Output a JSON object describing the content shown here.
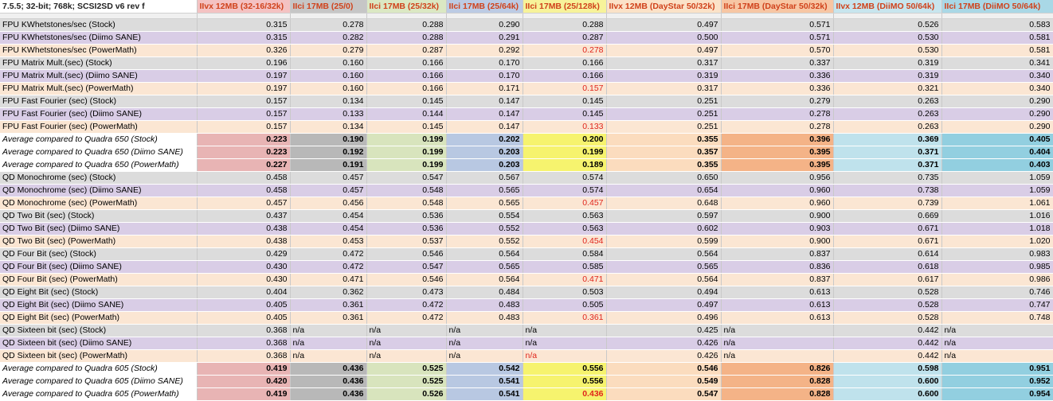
{
  "sheet": {
    "title": "7.5.5; 32-bit; 768k; SCSI2SD v6 rev f",
    "columns": [
      "IIvx 12MB (32-16/32k)",
      "IIci 17MB (25/0)",
      "IIci 17MB (25/32k)",
      "IIci 17MB (25/64k)",
      "IIci 17MB (25/128k)",
      "IIvx 12MB (DayStar 50/32k)",
      "IIci 17MB (DayStar 50/32k)",
      "IIvx 12MB (DiiMO 50/64k)",
      "IIci 17MB (DiiMO 50/64k)"
    ],
    "rows": [
      {
        "type": "stock",
        "label": "FPU KWhetstones/sec (Stock)",
        "values": [
          "0.315",
          "0.278",
          "0.288",
          "0.290",
          "0.288",
          "0.497",
          "0.571",
          "0.526",
          "0.583"
        ],
        "red": []
      },
      {
        "type": "diimo",
        "label": "FPU KWhetstones/sec (Diimo SANE)",
        "values": [
          "0.315",
          "0.282",
          "0.288",
          "0.291",
          "0.287",
          "0.500",
          "0.571",
          "0.530",
          "0.581"
        ],
        "red": []
      },
      {
        "type": "power",
        "label": "FPU KWhetstones/sec (PowerMath)",
        "values": [
          "0.326",
          "0.279",
          "0.287",
          "0.292",
          "0.278",
          "0.497",
          "0.570",
          "0.530",
          "0.581"
        ],
        "red": [
          4
        ]
      },
      {
        "type": "stock",
        "label": "FPU Matrix Mult.(sec) (Stock)",
        "values": [
          "0.196",
          "0.160",
          "0.166",
          "0.170",
          "0.166",
          "0.317",
          "0.337",
          "0.319",
          "0.341"
        ],
        "red": []
      },
      {
        "type": "diimo",
        "label": "FPU Matrix Mult.(sec) (Diimo SANE)",
        "values": [
          "0.197",
          "0.160",
          "0.166",
          "0.170",
          "0.166",
          "0.319",
          "0.336",
          "0.319",
          "0.340"
        ],
        "red": []
      },
      {
        "type": "power",
        "label": "FPU Matrix Mult.(sec) (PowerMath)",
        "values": [
          "0.197",
          "0.160",
          "0.166",
          "0.171",
          "0.157",
          "0.317",
          "0.336",
          "0.321",
          "0.340"
        ],
        "red": [
          4
        ]
      },
      {
        "type": "stock",
        "label": "FPU Fast Fourier (sec) (Stock)",
        "values": [
          "0.157",
          "0.134",
          "0.145",
          "0.147",
          "0.145",
          "0.251",
          "0.279",
          "0.263",
          "0.290"
        ],
        "red": []
      },
      {
        "type": "diimo",
        "label": "FPU Fast Fourier (sec) (Diimo SANE)",
        "values": [
          "0.157",
          "0.133",
          "0.144",
          "0.147",
          "0.145",
          "0.251",
          "0.278",
          "0.263",
          "0.290"
        ],
        "red": []
      },
      {
        "type": "power",
        "label": "FPU Fast Fourier (sec) (PowerMath)",
        "values": [
          "0.157",
          "0.134",
          "0.145",
          "0.147",
          "0.133",
          "0.251",
          "0.278",
          "0.263",
          "0.290"
        ],
        "red": [
          4
        ]
      },
      {
        "type": "avg",
        "label": "Average compared to Quadra 650 (Stock)",
        "values": [
          "0.223",
          "0.190",
          "0.199",
          "0.202",
          "0.200",
          "0.355",
          "0.396",
          "0.369",
          "0.405"
        ],
        "red": []
      },
      {
        "type": "avg",
        "label": "Average compared to Quadra 650 (Diimo SANE)",
        "values": [
          "0.223",
          "0.192",
          "0.199",
          "0.203",
          "0.199",
          "0.357",
          "0.395",
          "0.371",
          "0.404"
        ],
        "red": []
      },
      {
        "type": "avg",
        "label": "Average compared to Quadra 650 (PowerMath)",
        "values": [
          "0.227",
          "0.191",
          "0.199",
          "0.203",
          "0.189",
          "0.355",
          "0.395",
          "0.371",
          "0.403"
        ],
        "red": []
      },
      {
        "type": "stock",
        "label": "QD Monochrome (sec) (Stock)",
        "values": [
          "0.458",
          "0.457",
          "0.547",
          "0.567",
          "0.574",
          "0.650",
          "0.956",
          "0.735",
          "1.059"
        ],
        "red": []
      },
      {
        "type": "diimo",
        "label": "QD Monochrome (sec) (Diimo SANE)",
        "values": [
          "0.458",
          "0.457",
          "0.548",
          "0.565",
          "0.574",
          "0.654",
          "0.960",
          "0.738",
          "1.059"
        ],
        "red": []
      },
      {
        "type": "power",
        "label": "QD Monochrome (sec) (PowerMath)",
        "values": [
          "0.457",
          "0.456",
          "0.548",
          "0.565",
          "0.457",
          "0.648",
          "0.960",
          "0.739",
          "1.061"
        ],
        "red": [
          4
        ]
      },
      {
        "type": "stock",
        "label": "QD Two Bit (sec) (Stock)",
        "values": [
          "0.437",
          "0.454",
          "0.536",
          "0.554",
          "0.563",
          "0.597",
          "0.900",
          "0.669",
          "1.016"
        ],
        "red": []
      },
      {
        "type": "diimo",
        "label": "QD Two Bit (sec) (Diimo SANE)",
        "values": [
          "0.438",
          "0.454",
          "0.536",
          "0.552",
          "0.563",
          "0.602",
          "0.903",
          "0.671",
          "1.018"
        ],
        "red": []
      },
      {
        "type": "power",
        "label": "QD Two Bit (sec) (PowerMath)",
        "values": [
          "0.438",
          "0.453",
          "0.537",
          "0.552",
          "0.454",
          "0.599",
          "0.900",
          "0.671",
          "1.020"
        ],
        "red": [
          4
        ]
      },
      {
        "type": "stock",
        "label": "QD Four Bit (sec) (Stock)",
        "values": [
          "0.429",
          "0.472",
          "0.546",
          "0.564",
          "0.584",
          "0.564",
          "0.837",
          "0.614",
          "0.983"
        ],
        "red": []
      },
      {
        "type": "diimo",
        "label": "QD Four Bit (sec) (Diimo SANE)",
        "values": [
          "0.430",
          "0.472",
          "0.547",
          "0.565",
          "0.585",
          "0.565",
          "0.836",
          "0.618",
          "0.985"
        ],
        "red": []
      },
      {
        "type": "power",
        "label": "QD Four Bit (sec) (PowerMath)",
        "values": [
          "0.430",
          "0.471",
          "0.546",
          "0.564",
          "0.471",
          "0.564",
          "0.837",
          "0.617",
          "0.986"
        ],
        "red": [
          4
        ]
      },
      {
        "type": "stock",
        "label": "QD Eight Bit (sec) (Stock)",
        "values": [
          "0.404",
          "0.362",
          "0.473",
          "0.484",
          "0.503",
          "0.494",
          "0.613",
          "0.528",
          "0.746"
        ],
        "red": []
      },
      {
        "type": "diimo",
        "label": "QD Eight Bit (sec) (Diimo SANE)",
        "values": [
          "0.405",
          "0.361",
          "0.472",
          "0.483",
          "0.505",
          "0.497",
          "0.613",
          "0.528",
          "0.747"
        ],
        "red": []
      },
      {
        "type": "power",
        "label": "QD Eight Bit (sec) (PowerMath)",
        "values": [
          "0.405",
          "0.361",
          "0.472",
          "0.483",
          "0.361",
          "0.496",
          "0.613",
          "0.528",
          "0.748"
        ],
        "red": [
          4
        ]
      },
      {
        "type": "stock",
        "label": "QD Sixteen bit (sec) (Stock)",
        "values": [
          "0.368",
          "n/a",
          "n/a",
          "n/a",
          "n/a",
          "0.425",
          "n/a",
          "0.442",
          "n/a"
        ],
        "red": []
      },
      {
        "type": "diimo",
        "label": "QD Sixteen bit (sec) (Diimo SANE)",
        "values": [
          "0.368",
          "n/a",
          "n/a",
          "n/a",
          "n/a",
          "0.426",
          "n/a",
          "0.442",
          "n/a"
        ],
        "red": []
      },
      {
        "type": "power",
        "label": "QD Sixteen bit (sec) (PowerMath)",
        "values": [
          "0.368",
          "n/a",
          "n/a",
          "n/a",
          "n/a",
          "0.426",
          "n/a",
          "0.442",
          "n/a"
        ],
        "red": [
          4
        ]
      },
      {
        "type": "avg",
        "label": "Average compared to Quadra 605 (Stock)",
        "values": [
          "0.419",
          "0.436",
          "0.525",
          "0.542",
          "0.556",
          "0.546",
          "0.826",
          "0.598",
          "0.951"
        ],
        "red": []
      },
      {
        "type": "avg",
        "label": "Average compared to Quadra 605 (Diimo SANE)",
        "values": [
          "0.420",
          "0.436",
          "0.525",
          "0.541",
          "0.556",
          "0.549",
          "0.828",
          "0.600",
          "0.952"
        ],
        "red": []
      },
      {
        "type": "avg",
        "label": "Average compared to Quadra 605 (PowerMath)",
        "values": [
          "0.419",
          "0.436",
          "0.526",
          "0.541",
          "0.436",
          "0.547",
          "0.828",
          "0.600",
          "0.954"
        ],
        "red": [
          4
        ]
      }
    ]
  }
}
